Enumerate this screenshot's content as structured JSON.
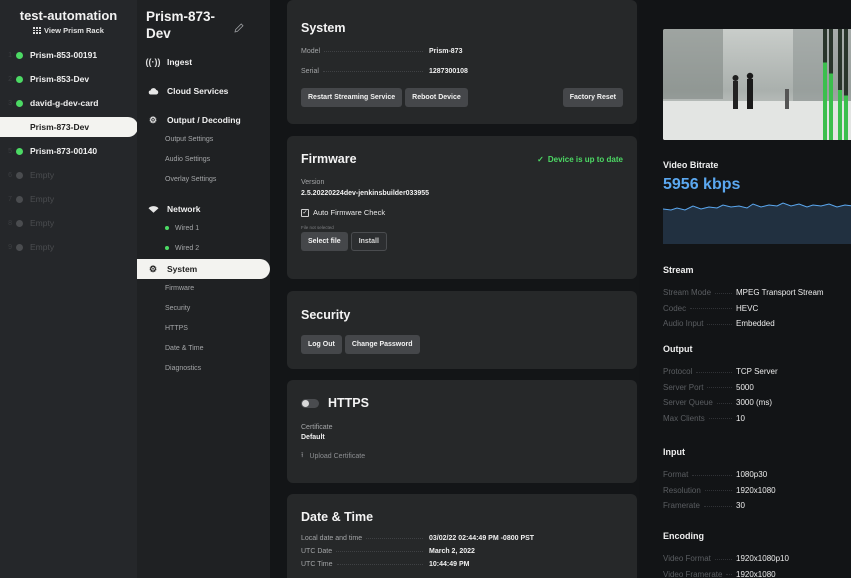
{
  "devices": {
    "title": "test-automation",
    "rack_link": "View Prism Rack",
    "items": [
      {
        "num": "1",
        "name": "Prism-853-00191",
        "state": "online"
      },
      {
        "num": "2",
        "name": "Prism-853-Dev",
        "state": "online"
      },
      {
        "num": "3",
        "name": "david-g-dev-card",
        "state": "online"
      },
      {
        "num": "4",
        "name": "Prism-873-Dev",
        "state": "active"
      },
      {
        "num": "5",
        "name": "Prism-873-00140",
        "state": "online"
      },
      {
        "num": "6",
        "name": "Empty",
        "state": "empty"
      },
      {
        "num": "7",
        "name": "Empty",
        "state": "empty"
      },
      {
        "num": "8",
        "name": "Empty",
        "state": "empty"
      },
      {
        "num": "9",
        "name": "Empty",
        "state": "empty"
      }
    ]
  },
  "nav": {
    "device_name": "Prism-873-Dev",
    "ingest": "Ingest",
    "cloud_services": "Cloud Services",
    "output_decoding": "Output / Decoding",
    "output_settings": "Output Settings",
    "audio_settings": "Audio Settings",
    "overlay_settings": "Overlay Settings",
    "network": "Network",
    "wired1": "Wired 1",
    "wired2": "Wired 2",
    "system": "System",
    "firmware": "Firmware",
    "security": "Security",
    "https": "HTTPS",
    "date_time": "Date & Time",
    "diagnostics": "Diagnostics"
  },
  "system": {
    "title": "System",
    "model_label": "Model",
    "model": "Prism-873",
    "serial_label": "Serial",
    "serial": "1287300108",
    "restart_btn": "Restart Streaming Service",
    "reboot_btn": "Reboot Device",
    "factory_btn": "Factory Reset"
  },
  "firmware": {
    "title": "Firmware",
    "status": "Device is up to date",
    "version_label": "Version",
    "version": "2.5.20220224dev-jenkinsbuilder033955",
    "auto_check": "Auto Firmware Check",
    "file_status": "File not selected",
    "select_btn": "Select file",
    "install_btn": "Install"
  },
  "security": {
    "title": "Security",
    "logout_btn": "Log Out",
    "change_pw_btn": "Change Password"
  },
  "https": {
    "title": "HTTPS",
    "cert_label": "Certificate",
    "cert_value": "Default",
    "upload_btn": "Upload Certificate"
  },
  "datetime": {
    "title": "Date & Time",
    "local_label": "Local date and time",
    "local_value": "03/02/22 02:44:49 PM -0800 PST",
    "utc_date_label": "UTC Date",
    "utc_date": "March 2, 2022",
    "utc_time_label": "UTC Time",
    "utc_time": "10:44:49 PM"
  },
  "status": {
    "video_bitrate_label": "Video Bitrate",
    "video_bitrate": "5956 kbps",
    "stream": {
      "title": "Stream",
      "rows": [
        {
          "k": "Stream Mode",
          "v": "MPEG Transport Stream"
        },
        {
          "k": "Codec",
          "v": "HEVC"
        },
        {
          "k": "Audio Input",
          "v": "Embedded"
        }
      ]
    },
    "output": {
      "title": "Output",
      "rows": [
        {
          "k": "Protocol",
          "v": "TCP Server"
        },
        {
          "k": "Server Port",
          "v": "5000"
        },
        {
          "k": "Server Queue",
          "v": "3000 (ms)"
        },
        {
          "k": "Max Clients",
          "v": "10"
        }
      ]
    },
    "input": {
      "title": "Input",
      "rows": [
        {
          "k": "Format",
          "v": "1080p30"
        },
        {
          "k": "Resolution",
          "v": "1920x1080"
        },
        {
          "k": "Framerate",
          "v": "30"
        }
      ]
    },
    "encoding": {
      "title": "Encoding",
      "rows": [
        {
          "k": "Video Format",
          "v": "1920x1080p10"
        },
        {
          "k": "Video Framerate",
          "v": "1920x1080"
        }
      ]
    }
  },
  "colors": {
    "accent_green": "#4cd964",
    "bitrate_blue": "#5ba8f0"
  }
}
